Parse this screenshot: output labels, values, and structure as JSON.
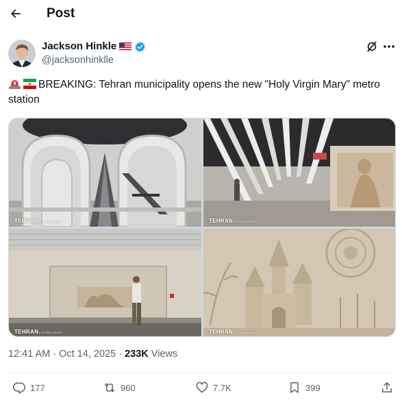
{
  "header": {
    "title": "Post",
    "back_icon": "arrow-left-icon"
  },
  "author": {
    "name": "Jackson Hinkle",
    "handle": "@jacksonhinklle",
    "flag_icon": "us-flag-icon",
    "verified_icon": "verified-badge-icon",
    "verified_color": "#1d9bf0"
  },
  "tweet": {
    "emojis": [
      "police-light-emoji",
      "iran-flag-emoji"
    ],
    "text": "BREAKING: Tehran municipality opens the new \"Holy Virgin Mary\" metro station"
  },
  "media": {
    "watermark": "TEHRAN",
    "watermark_small": "PICTURE AGENCY",
    "photos": [
      {
        "subject": "arched-hall-escalators"
      },
      {
        "subject": "ribbed-ceiling-relief-wall"
      },
      {
        "subject": "corridor-with-passenger"
      },
      {
        "subject": "church-relief-carving"
      }
    ]
  },
  "meta": {
    "time": "12:41 AM",
    "separator": " · ",
    "date": "Oct 14, 2025",
    "views_count": "233K",
    "views_label": " Views"
  },
  "actions": {
    "replies": "177",
    "reposts": "960",
    "likes": "7.7K",
    "bookmarks": "399"
  },
  "colors": {
    "text": "#0f1419",
    "secondary": "#536471",
    "accent": "#1d9bf0",
    "border": "#cfd9de"
  }
}
